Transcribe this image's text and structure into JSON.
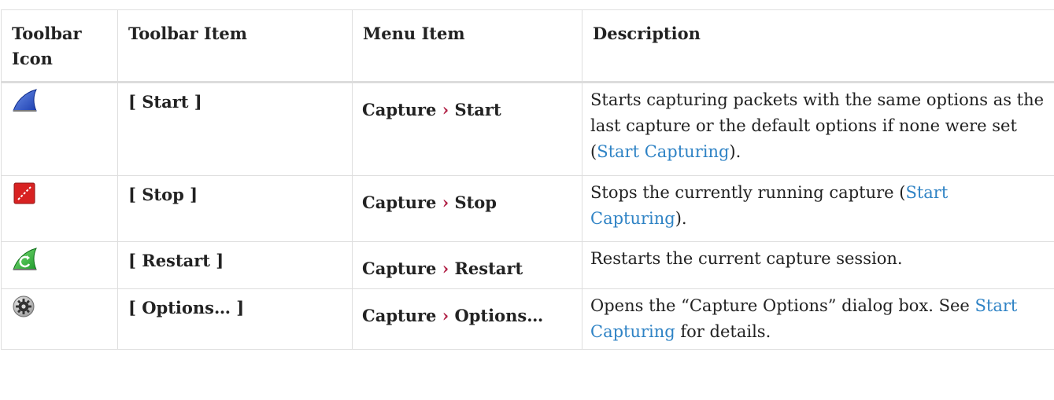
{
  "table": {
    "headers": [
      "Toolbar Icon",
      "Toolbar Item",
      "Menu Item",
      "Description"
    ],
    "menu_separator": "›",
    "rows": [
      {
        "icon": "shark-fin-blue-icon",
        "toolbar_item": "[ Start ]",
        "menu_parent": "Capture",
        "menu_child": "Start",
        "desc_before": "Starts capturing packets with the same options as the last capture or the default options if none were set (",
        "link": "Start Capturing",
        "desc_after": ")."
      },
      {
        "icon": "stop-red-square-icon",
        "toolbar_item": "[ Stop ]",
        "menu_parent": "Capture",
        "menu_child": "Stop",
        "desc_before": "Stops the currently running capture (",
        "link": "Start Capturing",
        "desc_after": ")."
      },
      {
        "icon": "restart-green-fin-icon",
        "toolbar_item": "[ Restart ]",
        "menu_parent": "Capture",
        "menu_child": "Restart",
        "desc_before": "Restarts the current capture session."
      },
      {
        "icon": "gear-icon",
        "toolbar_item": "[ Options… ]",
        "menu_parent": "Capture",
        "menu_child": "Options…",
        "desc_before": "Opens the “Capture Options” dialog box. See ",
        "link": "Start Capturing",
        "desc_after": " for details."
      }
    ]
  },
  "colors": {
    "link": "#2f83c5",
    "menu_caret": "#b12146",
    "border": "#dedede"
  }
}
